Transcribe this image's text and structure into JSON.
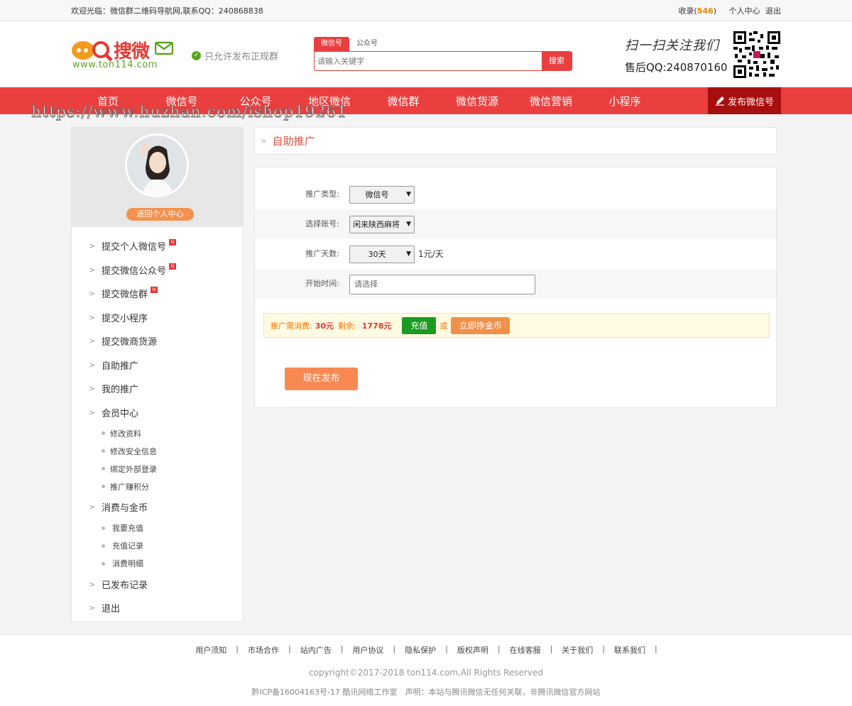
{
  "topbar": {
    "welcome": "欢迎光临：微信群二维码导航网,联系QQ：240868838",
    "collect_label": "收录(",
    "collect_count": "546",
    "collect_close": ")",
    "user_center": "个人中心",
    "logout": "退出"
  },
  "header": {
    "logo_text": "搜微",
    "logo_url": "www.ton114.com",
    "notice": "只允许发布正规群",
    "search_tabs": [
      "微信号",
      "公众号"
    ],
    "search_placeholder": "请输入关键字",
    "search_button": "搜索",
    "follow_text": "扫一扫关注我们",
    "service_qq": "售后QQ:240870160"
  },
  "nav": {
    "items": [
      "首页",
      "微信号",
      "公众号",
      "地区微信",
      "微信群",
      "微信货源",
      "微信营销",
      "小程序"
    ],
    "publish": "发布微信号"
  },
  "watermark": "https://www.huzhan.com/ishop19261",
  "sidebar": {
    "back_label": "返回个人中心",
    "items": [
      {
        "label": "提交个人微信号",
        "new": true
      },
      {
        "label": "提交微信公众号",
        "new": true
      },
      {
        "label": "提交微信群",
        "new": true
      },
      {
        "label": "提交小程序",
        "new": false
      },
      {
        "label": "提交微商货源",
        "new": false
      },
      {
        "label": "自助推广",
        "new": false
      },
      {
        "label": "我的推广",
        "new": false
      },
      {
        "label": "会员中心",
        "new": false
      }
    ],
    "member_sub": [
      "修改资料",
      "修改安全信息",
      "绑定外部登录",
      "推广赚积分"
    ],
    "consume": "消费与金币",
    "consume_sub": [
      "我要充值",
      "充值记录",
      "消费明细"
    ],
    "published": "已发布记录",
    "exit": "退出",
    "new_badge": "N"
  },
  "page": {
    "title": "自助推广"
  },
  "form": {
    "type_label": "推广类型:",
    "type_value": "微信号",
    "account_label": "选择账号:",
    "account_value": "闲来陕西麻将",
    "days_label": "推广天数:",
    "days_value": "30天",
    "days_unit": "1元/天",
    "start_label": "开始时间:",
    "start_placeholder": "请选择",
    "cost_label": "推广需消费:",
    "cost_value": "30元",
    "balance_label": "剩余:",
    "balance_value": "1778元",
    "recharge": "充值",
    "or": "或",
    "earn": "立即挣金币",
    "submit": "现在发布"
  },
  "footer": {
    "links": [
      "用户须知",
      "市场合作",
      "站内广告",
      "用户协议",
      "隐私保护",
      "版权声明",
      "在线客服",
      "关于我们",
      "联系我们"
    ],
    "copyright": "copyright©2017-2018 ton114.com,All Rights Reserved",
    "icp": "黔ICP备16004163号-17 酷讯网络工作室　声明：本站与腾讯微信无任何关联，非腾讯微信官方网站"
  },
  "colors": {
    "brand_red": "#ea3f3f",
    "nav_publish": "#a70f0f",
    "orange": "#f98953",
    "green": "#1a9b22"
  }
}
